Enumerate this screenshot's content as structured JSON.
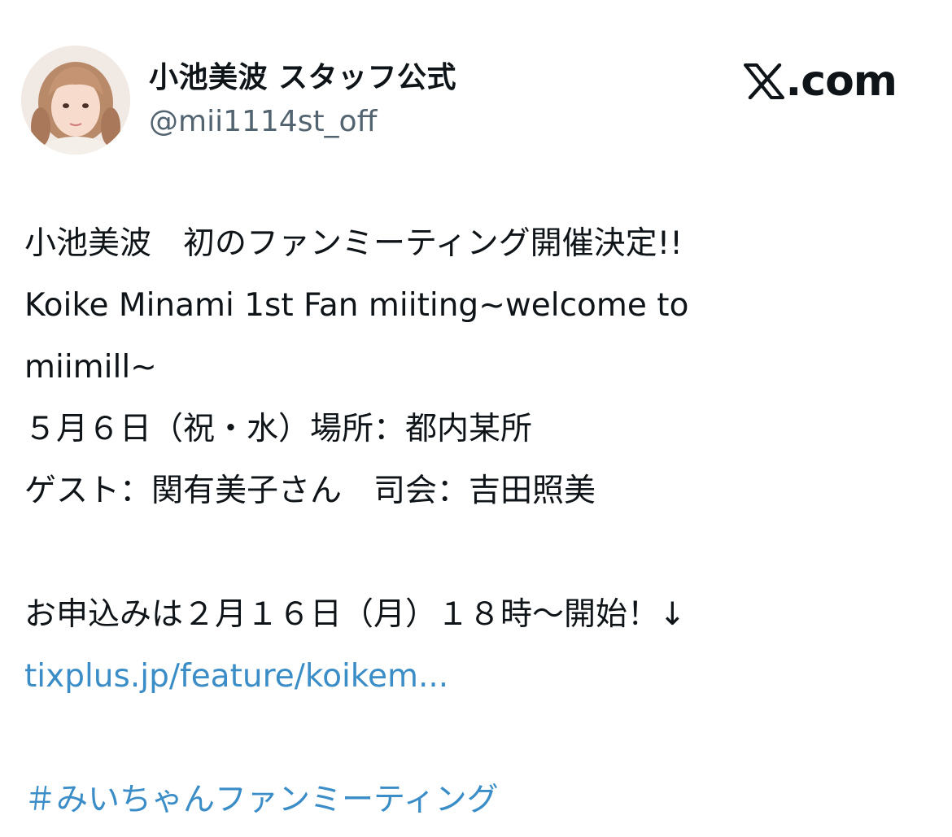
{
  "user": {
    "display_name": "小池美波 スタッフ公式",
    "handle": "@mii1114st_off"
  },
  "brand": {
    "text": ".com",
    "icon": "x-logo-icon"
  },
  "tweet": {
    "line1": "小池美波　初のファンミーティング開催決定!!",
    "line2": "Koike Minami 1st Fan miiting~welcome to",
    "line3": "miimill~",
    "line4": "５月６日（祝・水）場所：都内某所",
    "line5": "ゲスト：関有美子さん　司会：吉田照美",
    "line6": "お申込みは２月１６日（月）１８時〜開始！↓",
    "link": "tixplus.jp/feature/koikem...",
    "hashtag": "＃みいちゃんファンミーティング"
  },
  "colors": {
    "text": "#0f1419",
    "secondary": "#536471",
    "link": "#3a8dc7"
  }
}
